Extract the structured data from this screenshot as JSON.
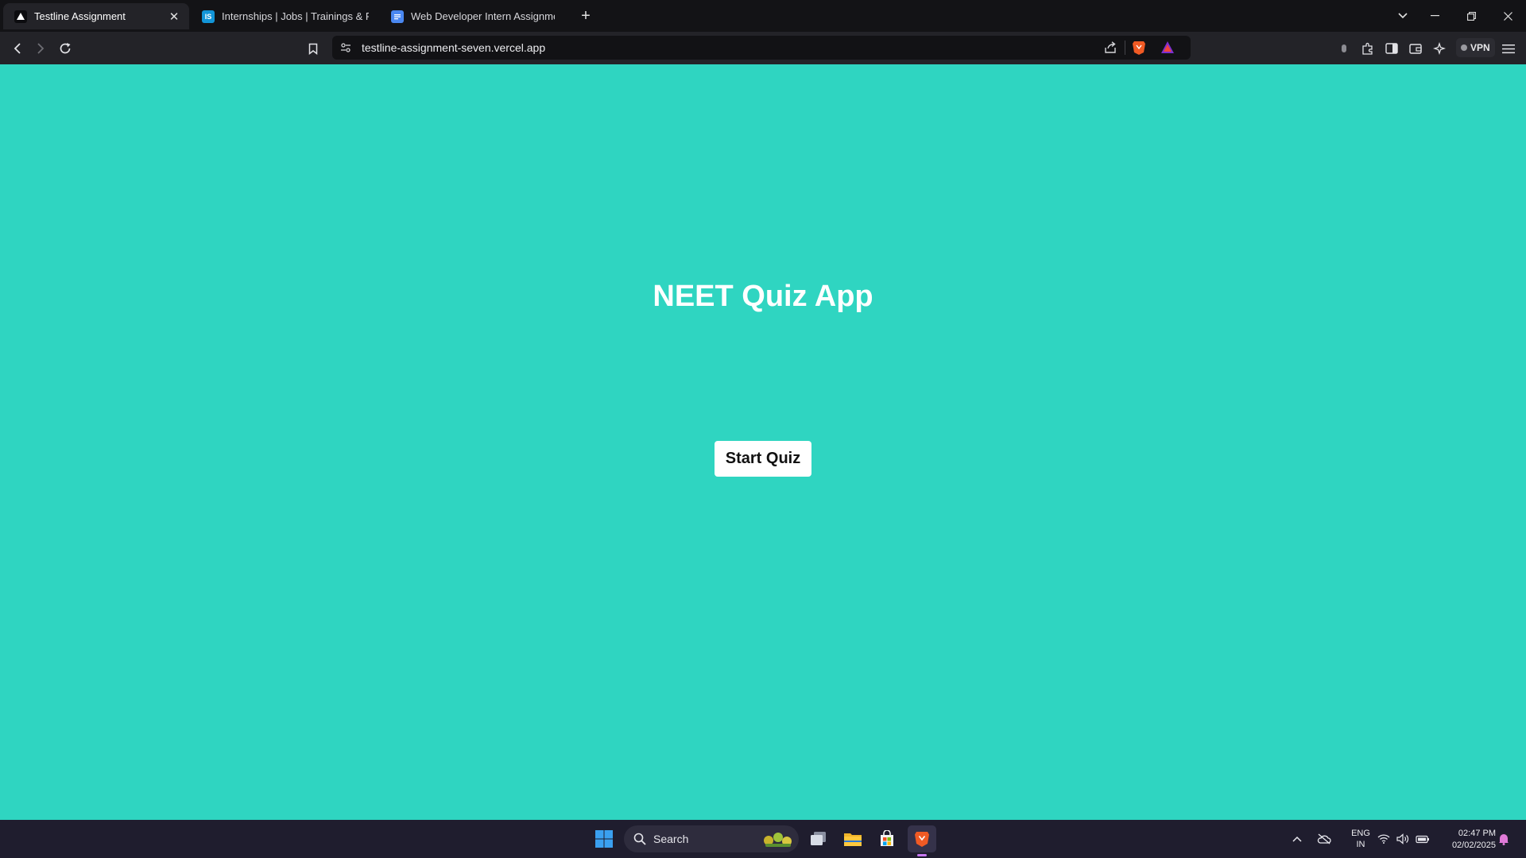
{
  "browser": {
    "tabs": [
      {
        "title": "Testline Assignment",
        "active": true
      },
      {
        "title": "Internships | Jobs | Trainings & Place",
        "favicon_text": "IS"
      },
      {
        "title": "Web Developer Intern Assignment -"
      }
    ],
    "url": "testline-assignment-seven.vercel.app",
    "vpn_label": "VPN"
  },
  "page": {
    "title": "NEET Quiz App",
    "start_button_label": "Start Quiz",
    "background_color": "#2fd5c1"
  },
  "taskbar": {
    "search_label": "Search",
    "language_line1": "ENG",
    "language_line2": "IN",
    "time": "02:47 PM",
    "date": "02/02/2025"
  }
}
